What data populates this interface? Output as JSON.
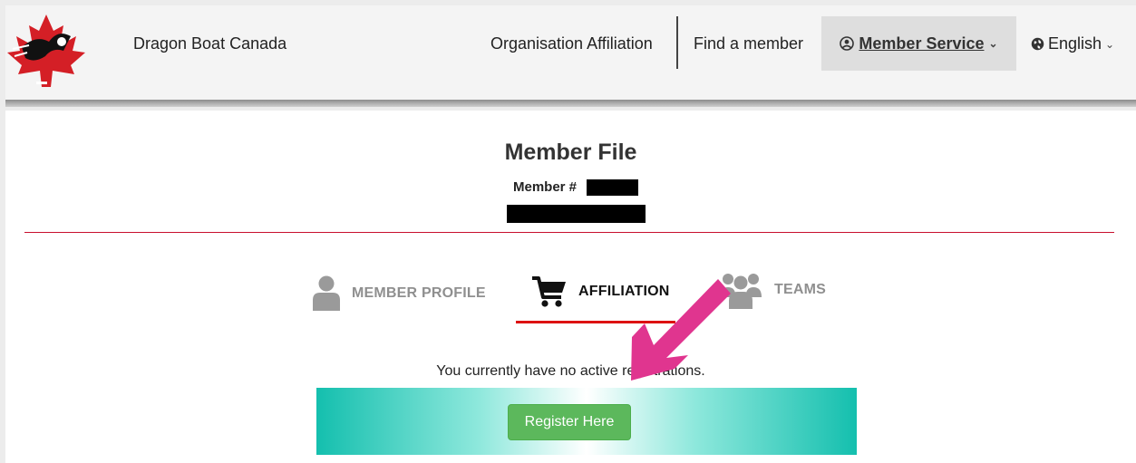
{
  "header": {
    "brand": "Dragon Boat Canada",
    "nav": {
      "org_affiliation": "Organisation Affiliation",
      "find_member": "Find a member",
      "member_service": "Member Service",
      "language": "English"
    }
  },
  "page": {
    "title": "Member File",
    "member_label": "Member #"
  },
  "tabs": {
    "profile": "MEMBER PROFILE",
    "affiliation": "AFFILIATION",
    "teams": "TEAMS",
    "active": "affiliation"
  },
  "status_message": "You currently have no active registrations.",
  "register_button": "Register Here",
  "colors": {
    "accent_red": "#d11111",
    "brand_red": "#c8102e",
    "button_green": "#5cb85c",
    "banner_teal": "#14bfae",
    "annotation_arrow": "#e0358f"
  },
  "icons": [
    "logo-maple-leaf",
    "user-circle-icon",
    "globe-icon",
    "chevron-down-icon",
    "user-icon",
    "cart-icon",
    "users-icon"
  ]
}
